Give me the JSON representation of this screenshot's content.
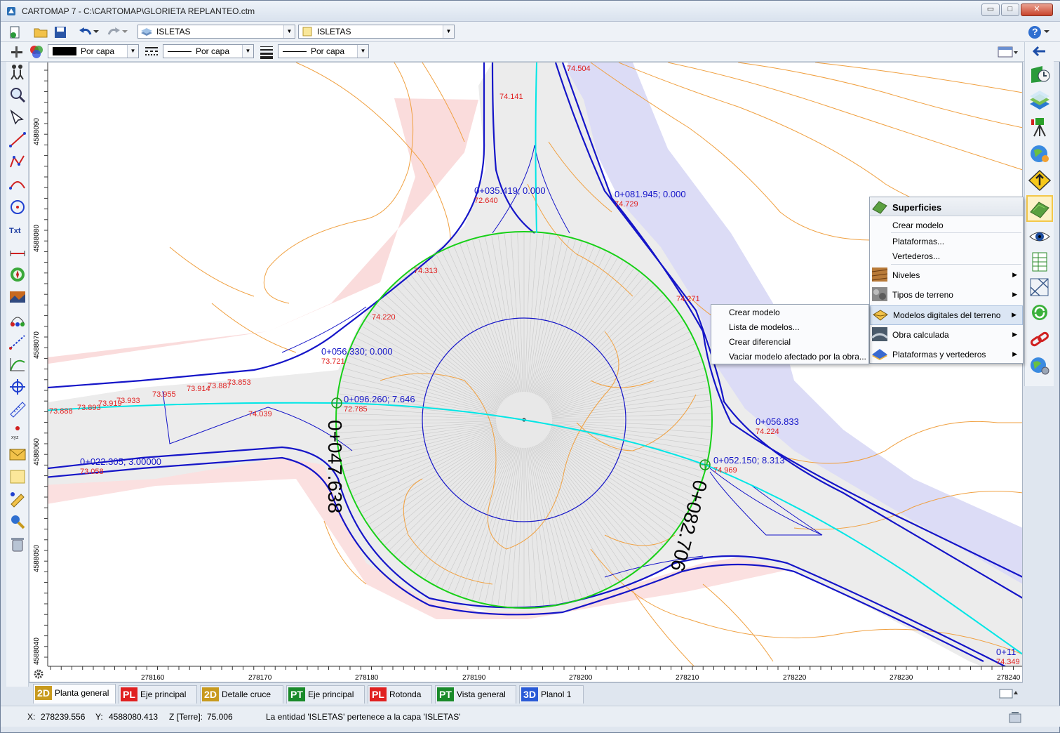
{
  "window": {
    "title": "CARTOMAP 7 - C:\\CARTOMAP\\GLORIETA REPLANTEO.ctm",
    "minimize": "▭",
    "maximize": "□",
    "close": "✕"
  },
  "toolbar": {
    "layer_select": "ISLETAS",
    "group_select": "ISLETAS",
    "color_select": "Por capa",
    "linetype_select": "Por capa",
    "lineweight_select": "Por capa",
    "help_label": "?"
  },
  "map": {
    "y_ticks": [
      "4588090",
      "4588080",
      "4588070",
      "4588060",
      "4588050",
      "4588040"
    ],
    "x_ticks": [
      "278160",
      "278170",
      "278180",
      "278190",
      "278200",
      "278210",
      "278220",
      "278230",
      "278240"
    ],
    "station_labels": [
      "0+035.419; 0.000",
      "0+081.945; 0.000",
      "0+056.330; 0.000",
      "0+096.260; 7.646",
      "0+022.305; 3.00000",
      "0+052.150; 8.313",
      "0+056.833",
      "0+11"
    ],
    "big_labels": [
      "0+047.638",
      "0+082.706"
    ],
    "elevations": [
      "74.504",
      "74.141",
      "72.640",
      "74.729",
      "74.313",
      "74.271",
      "74.220",
      "73.721",
      "72.785",
      "73.853",
      "73.887",
      "73.914",
      "73.955",
      "73.933",
      "73.919",
      "73.893",
      "73.888",
      "74.039",
      "73.058",
      "74.224",
      "74.969",
      "74.349"
    ]
  },
  "context_menu": {
    "header": "Superficies",
    "items": [
      {
        "label": "Crear modelo",
        "submenu": false
      },
      {
        "label": "Plataformas...",
        "submenu": false
      },
      {
        "label": "Vertederos...",
        "submenu": false
      },
      {
        "label": "Niveles",
        "submenu": true
      },
      {
        "label": "Tipos de terreno",
        "submenu": true
      },
      {
        "label": "Modelos digitales del terreno",
        "submenu": true
      },
      {
        "label": "Obra calculada",
        "submenu": true
      },
      {
        "label": "Plataformas y vertederos",
        "submenu": true
      }
    ],
    "submenu_arrow": "▶"
  },
  "submenu": {
    "items": [
      "Crear modelo",
      "Lista de modelos...",
      "Crear diferencial",
      "Vaciar modelo afectado por la obra..."
    ]
  },
  "tabs": [
    {
      "badge": "2D",
      "label": "Planta general",
      "color": "#c89a1e",
      "active": true
    },
    {
      "badge": "PL",
      "label": "Eje principal",
      "color": "#e02020",
      "active": false
    },
    {
      "badge": "2D",
      "label": "Detalle cruce",
      "color": "#c89a1e",
      "active": false
    },
    {
      "badge": "PT",
      "label": "Eje principal",
      "color": "#1a8a2a",
      "active": false
    },
    {
      "badge": "PL",
      "label": "Rotonda",
      "color": "#e02020",
      "active": false
    },
    {
      "badge": "PT",
      "label": "Vista general",
      "color": "#1a8a2a",
      "active": false
    },
    {
      "badge": "3D",
      "label": "Planol 1",
      "color": "#2a5bd7",
      "active": false
    }
  ],
  "status": {
    "x_label": "X:",
    "x_value": "278239.556",
    "y_label": "Y:",
    "y_value": "4588080.413",
    "z_label": "Z [Terre]:",
    "z_value": "75.006",
    "message": "La entidad 'ISLETAS' pertenece a la capa 'ISLETAS'"
  },
  "colors": {
    "road_edge": "#1515c8",
    "axis": "#00e6e6",
    "circle": "#18d018",
    "contour": "#f0a040",
    "fill_pink": "#f8d0d0",
    "fill_lavender": "#d8d8f6",
    "elev_text": "#e02020",
    "station_text": "#1515c8"
  }
}
